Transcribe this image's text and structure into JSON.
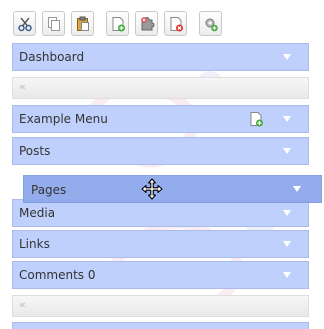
{
  "toolbar": {
    "buttons": [
      {
        "name": "cut-button",
        "icon": "scissors-icon"
      },
      {
        "name": "copy-button",
        "icon": "copy-icon"
      },
      {
        "name": "paste-button",
        "icon": "paste-icon"
      },
      {
        "name": "add-page-button",
        "icon": "add-page-icon"
      },
      {
        "name": "add-plugin-button",
        "icon": "puzzle-add-icon"
      },
      {
        "name": "delete-page-button",
        "icon": "delete-page-icon"
      },
      {
        "name": "settings-button",
        "icon": "gear-add-icon"
      }
    ]
  },
  "menus": {
    "dashboard": "Dashboard",
    "example_menu": "Example Menu",
    "posts": "Posts",
    "pages_dragged": "Pages",
    "media": "Media",
    "links": "Links",
    "comments": "Comments 0"
  },
  "collapse_glyph": "«",
  "colors": {
    "menu_bar": "#bed0fb",
    "menu_border": "#a9bde8",
    "drag_bar": "#8ea9ec"
  }
}
